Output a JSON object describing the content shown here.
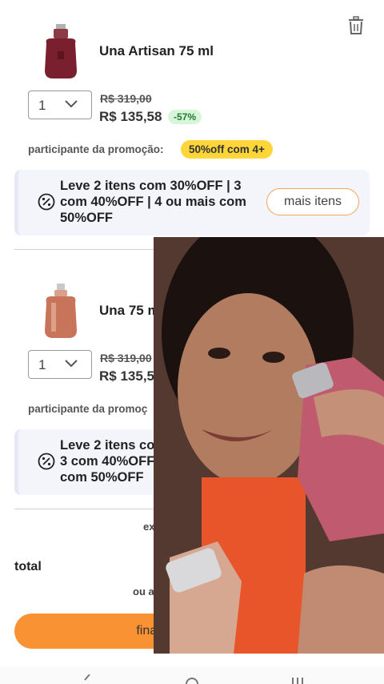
{
  "items": [
    {
      "name": "Una Artisan 75 ml",
      "quantity": "1",
      "old_price": "R$ 319,00",
      "new_price": "R$ 135,58",
      "discount": "-57%",
      "promo_label": "participante da promoção:",
      "promo_chip": "50%off com 4+",
      "promo_text": "Leve 2 itens com 30%OFF | 3 com 40%OFF | 4 ou mais com 50%OFF",
      "more_button": "mais itens",
      "bottle_color": "#7a1f2e"
    },
    {
      "name": "Una 75 m",
      "quantity": "1",
      "old_price": "R$ 319,00",
      "new_price": "R$ 135,5",
      "promo_label": "participante da promoç",
      "promo_text_line1": "Leve 2 itens co",
      "promo_text_line2": "3 com 40%OFF",
      "promo_text_line3": "com 50%OFF",
      "bottle_color": "#c8745a"
    }
  ],
  "summary": {
    "shipping_note": "exi",
    "total_label": "total",
    "install_note": "ou ate",
    "checkout_button": "final"
  },
  "colors": {
    "accent": "#f99233",
    "promo_chip": "#fed639",
    "discount_bg": "#d9f5d9",
    "discount_text": "#1e7a2e"
  },
  "icons": {
    "trash": "trash-icon",
    "chevron": "chevron-down-icon",
    "promo": "percent-badge-icon",
    "nav_back": "back-icon",
    "nav_home": "home-icon",
    "nav_recent": "recent-apps-icon"
  }
}
